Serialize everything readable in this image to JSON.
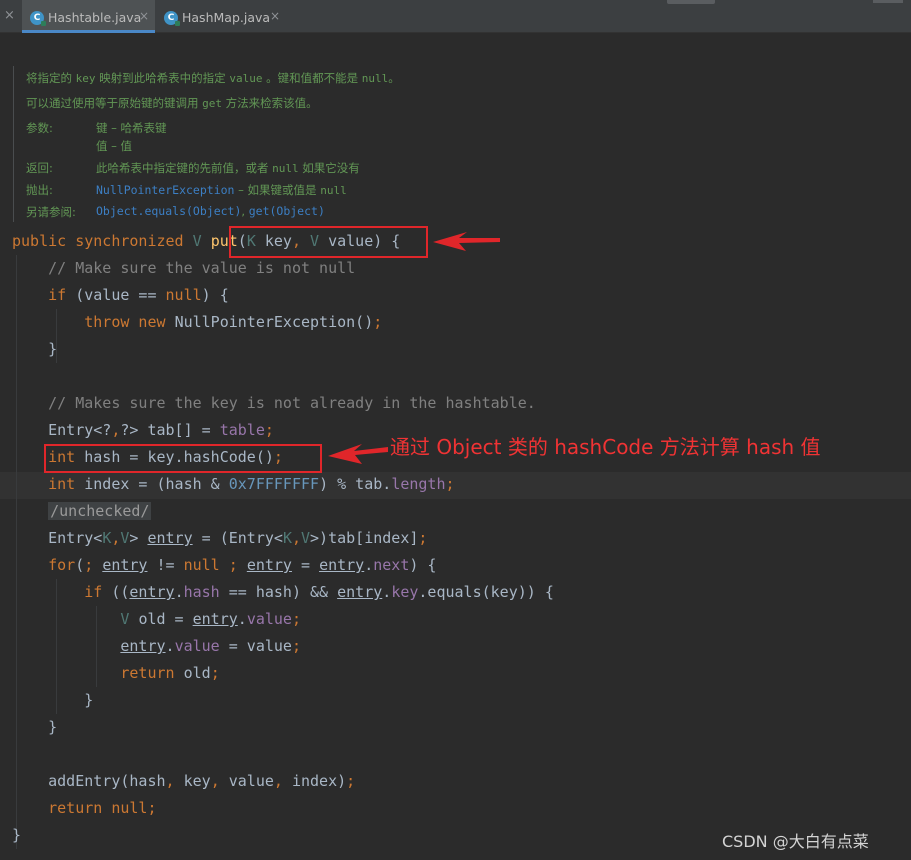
{
  "tabs": [
    {
      "label": "Hashtable.java",
      "icon_letter": "C",
      "active": true
    },
    {
      "label": "HashMap.java",
      "icon_letter": "C",
      "active": false
    }
  ],
  "tab_close_glyph": "×",
  "doc": {
    "desc1_a": "将指定的 ",
    "desc1_key": "key",
    "desc1_b": " 映射到此哈希表中的指定 ",
    "desc1_value": "value",
    "desc1_c": " 。键和值都不能是 ",
    "desc1_null": "null",
    "desc1_d": "。",
    "desc2_a": "可以通过使用等于原始键的键调用 ",
    "desc2_get": "get",
    "desc2_b": " 方法来检索该值。",
    "params_label": "参数:",
    "param1": "键 – 哈希表键",
    "param2": "值 – 值",
    "return_label": "返回:",
    "return_a": "此哈希表中指定键的先前值，或者 ",
    "return_null": "null",
    "return_b": " 如果它没有",
    "throws_label": "抛出:",
    "throws_ex": "NullPointerException",
    "throws_a": " – 如果键或值是 ",
    "throws_null": "null",
    "see_label": "另请参阅:",
    "see_link1": "Object.equals(Object)",
    "see_sep": ", ",
    "see_link2": "get(Object)"
  },
  "annotation": "通过 Object 类的 hashCode 方法计算 hash 值",
  "watermark": "CSDN @大白有点菜",
  "colors": {
    "background": "#2b2b2b",
    "keyword": "#cc7832",
    "comment": "#808080",
    "method": "#ffc66d",
    "number": "#6897bb",
    "field": "#9876aa",
    "doc": "#629755",
    "annotation_red": "#e0262a"
  },
  "icons": [
    "close-icon",
    "java-class-icon"
  ]
}
